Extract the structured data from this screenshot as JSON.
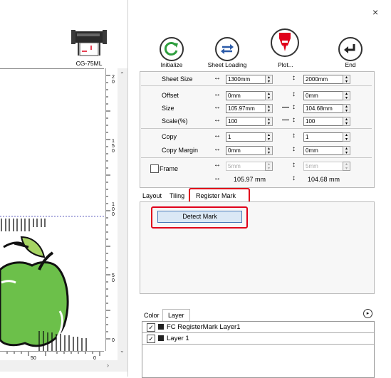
{
  "window": {
    "close_label": "×"
  },
  "device": {
    "name": "CG-75ML"
  },
  "toolbar": {
    "initialize_label": "Initialize",
    "sheet_loading_label": "Sheet Loading",
    "plot_label": "Plot...",
    "end_label": "End"
  },
  "settings": {
    "sheet_size_label": "Sheet Size",
    "sheet_width": "1300mm",
    "sheet_height": "2000mm",
    "offset_label": "Offset",
    "offset_x": "0mm",
    "offset_y": "0mm",
    "size_label": "Size",
    "size_w": "105.97mm",
    "size_h": "104.68mm",
    "scale_label": "Scale(%)",
    "scale_x": "100",
    "scale_y": "100",
    "copy_label": "Copy",
    "copy_x": "1",
    "copy_y": "1",
    "copy_margin_label": "Copy Margin",
    "copy_margin_x": "0mm",
    "copy_margin_y": "0mm",
    "frame_label": "Frame",
    "frame_x": "5mm",
    "frame_y": "5mm",
    "total_w": "105.97 mm",
    "total_h": "104.68 mm",
    "h_arrow": "↔",
    "v_arrow": "↕",
    "link_dash": "—"
  },
  "tabs": [
    "Layout",
    "Tiling",
    "Register Mark"
  ],
  "register_mark": {
    "detect_label": "Detect Mark"
  },
  "bottom_tabs": [
    "Color",
    "Layer"
  ],
  "layers": [
    {
      "name": "FC RegisterMark Layer1",
      "checked": true,
      "color": "#222222"
    },
    {
      "name": "Layer 1",
      "checked": true,
      "color": "#222222"
    }
  ],
  "rulers": {
    "v_labels": [
      "2\n0",
      "1\n5",
      "1\n0",
      "5\n0",
      "0"
    ],
    "h_labels": [
      "50",
      "0"
    ]
  },
  "colors": {
    "accent_red": "#e0001a",
    "icon_green": "#2e9e3e",
    "icon_blue": "#2a5aa8",
    "apple_green": "#6cc04a"
  }
}
